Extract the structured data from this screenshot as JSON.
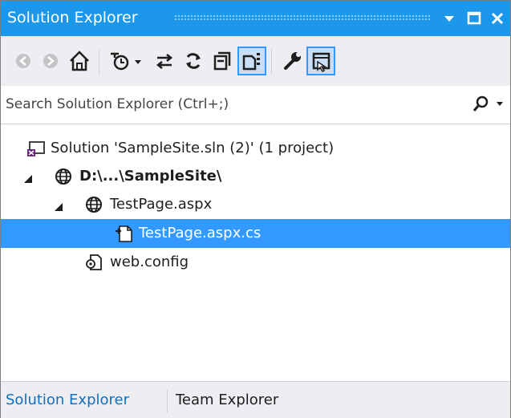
{
  "window": {
    "title": "Solution Explorer",
    "buttons": [
      {
        "icon": "dropdown-arrow-icon"
      },
      {
        "icon": "maximize-icon"
      },
      {
        "icon": "close-icon"
      }
    ]
  },
  "toolbar": {
    "tools": [
      {
        "icon": "back-icon"
      },
      {
        "icon": "forward-icon"
      },
      {
        "icon": "home-icon"
      },
      {
        "icon": "pending-changes-filter-icon"
      },
      {
        "icon": "sync-with-active-document-icon"
      },
      {
        "icon": "refresh-icon"
      },
      {
        "icon": "collapse-all-icon"
      },
      {
        "icon": "show-all-files-icon",
        "active": true
      },
      {
        "icon": "properties-icon"
      },
      {
        "icon": "preview-selected-items-icon",
        "active": true
      }
    ]
  },
  "search": {
    "placeholder": "Search Solution Explorer (Ctrl+;)",
    "icon": "search-icon"
  },
  "tree": {
    "nodes": [
      {
        "label": "Solution 'SampleSite.sln (2)' (1 project)",
        "icon": "solution-icon",
        "level": 0,
        "expanded": null,
        "bold": false,
        "selected": false
      },
      {
        "label": "D:\\...\\SampleSite\\",
        "icon": "website-globe-icon",
        "level": 1,
        "expanded": true,
        "bold": true,
        "selected": false
      },
      {
        "label": "TestPage.aspx",
        "icon": "web-page-globe-icon",
        "level": 2,
        "expanded": true,
        "bold": false,
        "selected": false
      },
      {
        "label": "TestPage.aspx.cs",
        "icon": "code-file-icon",
        "level": 3,
        "expanded": null,
        "bold": false,
        "selected": true
      },
      {
        "label": "web.config",
        "icon": "config-file-icon",
        "level": 2,
        "expanded": null,
        "bold": false,
        "selected": false
      }
    ]
  },
  "tabs": [
    {
      "label": "Solution Explorer",
      "active": true
    },
    {
      "label": "Team Explorer",
      "active": false
    }
  ],
  "colors": {
    "accent": "#1c97ea",
    "selection": "#3399ff",
    "toolbar_bg": "#eeeef2",
    "active_tab": "#0e70c0"
  }
}
